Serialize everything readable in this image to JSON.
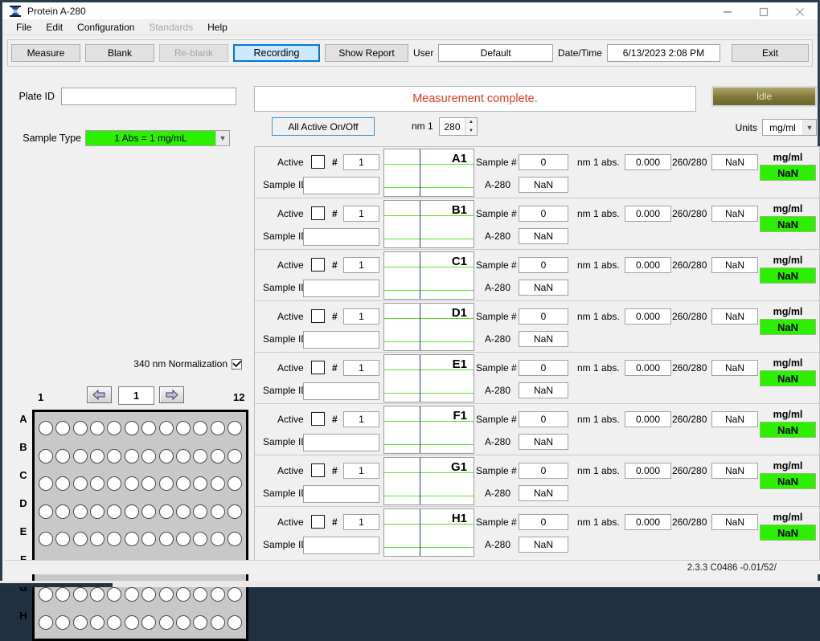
{
  "window": {
    "title": "Protein A-280",
    "icon": "spectrophotometer-icon",
    "minimize": "minimize-icon",
    "maximize": "maximize-icon",
    "close": "close-icon"
  },
  "menubar": {
    "items": [
      {
        "label": "File",
        "disabled": false
      },
      {
        "label": "Edit",
        "disabled": false
      },
      {
        "label": "Configuration",
        "disabled": false
      },
      {
        "label": "Standards",
        "disabled": true
      },
      {
        "label": "Help",
        "disabled": false
      }
    ]
  },
  "toolbar": {
    "measure": "Measure",
    "blank": "Blank",
    "reblank": "Re-blank",
    "recording": "Recording",
    "show_report": "Show Report",
    "user_label": "User",
    "user_value": "Default",
    "datetime_label": "Date/Time",
    "datetime_value": "6/13/2023  2:08 PM",
    "exit": "Exit"
  },
  "left_panel": {
    "plate_id_label": "Plate ID",
    "plate_id_value": "",
    "plate_id_placeholder": "",
    "sample_type_label": "Sample Type",
    "sample_type_value": "1 Abs = 1 mg/mL",
    "normalization_label": "340 nm Normalization",
    "normalization_checked": true,
    "plate_page": "1",
    "prev_icon": "arrow-left-icon",
    "next_icon": "arrow-right-icon",
    "col_first": "1",
    "col_last": "12",
    "row_labels": [
      "A",
      "B",
      "C",
      "D",
      "E",
      "F",
      "G",
      "H"
    ],
    "columns": 12,
    "rows": 8
  },
  "main": {
    "status_message": "Measurement complete.",
    "instrument_state": "Idle",
    "all_active_button": "All Active On/Off",
    "nm_label": "nm 1",
    "nm_value": "280",
    "units_label": "Units",
    "units_value": "mg/ml"
  },
  "sample_rows": [
    {
      "well": "A1",
      "active_label": "Active",
      "active": false,
      "hash_label": "#",
      "number": "1",
      "sample_id_label": "Sample ID",
      "sample_id": "",
      "sample_no_label": "Sample #",
      "sample_no": "0",
      "a280_label": "A-280",
      "a280": "NaN",
      "abs_label": "nm 1 abs.",
      "abs": "0.000",
      "ratio_label": "260/280",
      "ratio": "NaN",
      "units": "mg/ml",
      "concentration": "NaN"
    },
    {
      "well": "B1",
      "active_label": "Active",
      "active": false,
      "hash_label": "#",
      "number": "1",
      "sample_id_label": "Sample ID",
      "sample_id": "",
      "sample_no_label": "Sample #",
      "sample_no": "0",
      "a280_label": "A-280",
      "a280": "NaN",
      "abs_label": "nm 1 abs.",
      "abs": "0.000",
      "ratio_label": "260/280",
      "ratio": "NaN",
      "units": "mg/ml",
      "concentration": "NaN"
    },
    {
      "well": "C1",
      "active_label": "Active",
      "active": false,
      "hash_label": "#",
      "number": "1",
      "sample_id_label": "Sample ID",
      "sample_id": "",
      "sample_no_label": "Sample #",
      "sample_no": "0",
      "a280_label": "A-280",
      "a280": "NaN",
      "abs_label": "nm 1 abs.",
      "abs": "0.000",
      "ratio_label": "260/280",
      "ratio": "NaN",
      "units": "mg/ml",
      "concentration": "NaN"
    },
    {
      "well": "D1",
      "active_label": "Active",
      "active": false,
      "hash_label": "#",
      "number": "1",
      "sample_id_label": "Sample ID",
      "sample_id": "",
      "sample_no_label": "Sample #",
      "sample_no": "0",
      "a280_label": "A-280",
      "a280": "NaN",
      "abs_label": "nm 1 abs.",
      "abs": "0.000",
      "ratio_label": "260/280",
      "ratio": "NaN",
      "units": "mg/ml",
      "concentration": "NaN"
    },
    {
      "well": "E1",
      "active_label": "Active",
      "active": false,
      "hash_label": "#",
      "number": "1",
      "sample_id_label": "Sample ID",
      "sample_id": "",
      "sample_no_label": "Sample #",
      "sample_no": "0",
      "a280_label": "A-280",
      "a280": "NaN",
      "abs_label": "nm 1 abs.",
      "abs": "0.000",
      "ratio_label": "260/280",
      "ratio": "NaN",
      "units": "mg/ml",
      "concentration": "NaN"
    },
    {
      "well": "F1",
      "active_label": "Active",
      "active": false,
      "hash_label": "#",
      "number": "1",
      "sample_id_label": "Sample ID",
      "sample_id": "",
      "sample_no_label": "Sample #",
      "sample_no": "0",
      "a280_label": "A-280",
      "a280": "NaN",
      "abs_label": "nm 1 abs.",
      "abs": "0.000",
      "ratio_label": "260/280",
      "ratio": "NaN",
      "units": "mg/ml",
      "concentration": "NaN"
    },
    {
      "well": "G1",
      "active_label": "Active",
      "active": false,
      "hash_label": "#",
      "number": "1",
      "sample_id_label": "Sample ID",
      "sample_id": "",
      "sample_no_label": "Sample #",
      "sample_no": "0",
      "a280_label": "A-280",
      "a280": "NaN",
      "abs_label": "nm 1 abs.",
      "abs": "0.000",
      "ratio_label": "260/280",
      "ratio": "NaN",
      "units": "mg/ml",
      "concentration": "NaN"
    },
    {
      "well": "H1",
      "active_label": "Active",
      "active": false,
      "hash_label": "#",
      "number": "1",
      "sample_id_label": "Sample ID",
      "sample_id": "",
      "sample_no_label": "Sample #",
      "sample_no": "0",
      "a280_label": "A-280",
      "a280": "NaN",
      "abs_label": "nm 1 abs.",
      "abs": "0.000",
      "ratio_label": "260/280",
      "ratio": "NaN",
      "units": "mg/ml",
      "concentration": "NaN"
    }
  ],
  "statusbar": {
    "version": "2.3.3 C0486 -0.01/52/"
  },
  "colors": {
    "accent_blue": "#0078d7",
    "status_red": "#e03c28",
    "green_value": "#2cf000",
    "idle_olive": "#7e7736",
    "graph_line": "#5ee02a",
    "graph_marker": "#1d3f7a"
  }
}
